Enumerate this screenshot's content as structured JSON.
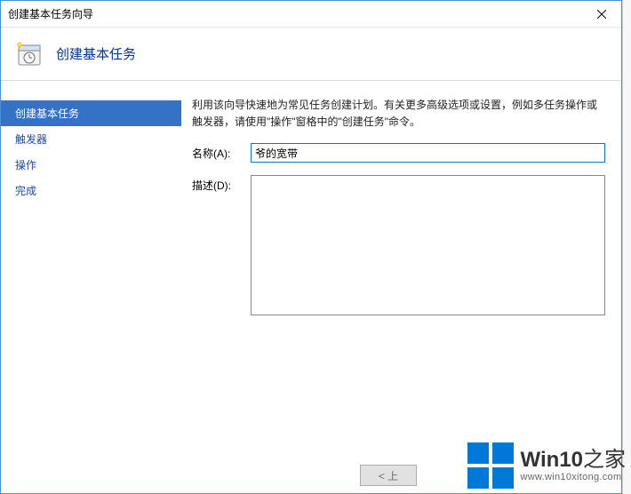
{
  "window": {
    "title": "创建基本任务向导"
  },
  "header": {
    "title": "创建基本任务"
  },
  "sidebar": {
    "steps": [
      {
        "label": "创建基本任务",
        "active": true
      },
      {
        "label": "触发器",
        "active": false
      },
      {
        "label": "操作",
        "active": false
      },
      {
        "label": "完成",
        "active": false
      }
    ]
  },
  "main": {
    "instructions": "利用该向导快速地为常见任务创建计划。有关更多高级选项或设置，例如多任务操作或触发器，请使用\"操作\"窗格中的\"创建任务\"命令。",
    "name_label": "名称(A):",
    "name_value": "爷的宽带",
    "desc_label": "描述(D):",
    "desc_value": ""
  },
  "footer": {
    "back_label": "< 上"
  },
  "watermark": {
    "brand_w": "Win10",
    "brand_suffix": "之家",
    "url": "www.win10xitong.com"
  }
}
